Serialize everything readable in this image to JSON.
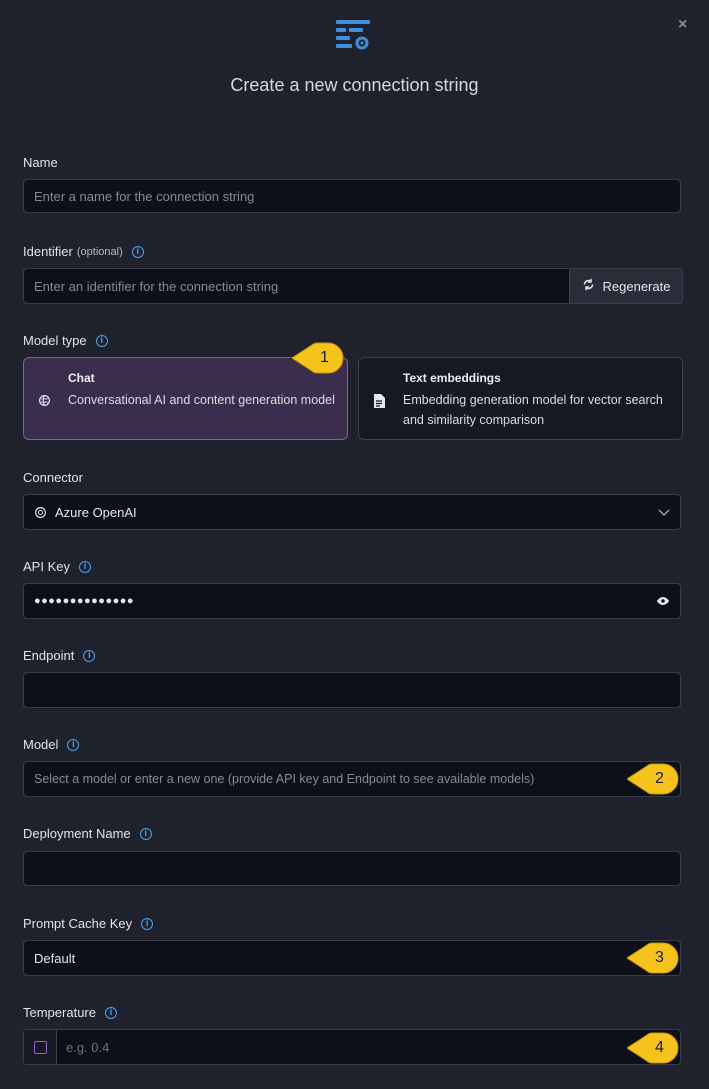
{
  "dialog": {
    "title": "Create a new connection string",
    "close_label": "×"
  },
  "name": {
    "label": "Name",
    "placeholder": "Enter a name for the connection string",
    "value": ""
  },
  "identifier": {
    "label": "Identifier",
    "optional": "(optional)",
    "placeholder": "Enter an identifier for the connection string",
    "regenerate_label": "Regenerate"
  },
  "model_type": {
    "label": "Model type",
    "options": [
      {
        "title": "Chat",
        "description": "Conversational AI and content generation model",
        "selected": true
      },
      {
        "title": "Text embeddings",
        "description": "Embedding generation model for vector search and similarity comparison",
        "selected": false
      }
    ]
  },
  "connector": {
    "label": "Connector",
    "value": "Azure OpenAI"
  },
  "api_key": {
    "label": "API Key",
    "value": "●●●●●●●●●●●●●●"
  },
  "endpoint": {
    "label": "Endpoint",
    "value": ""
  },
  "model": {
    "label": "Model",
    "placeholder": "Select a model or enter a new one (provide API key and Endpoint to see available models)"
  },
  "deployment_name": {
    "label": "Deployment Name",
    "value": ""
  },
  "prompt_cache_key": {
    "label": "Prompt Cache Key",
    "value": "Default"
  },
  "temperature": {
    "label": "Temperature",
    "placeholder": "e.g. 0.4",
    "enabled": false
  },
  "callouts": [
    "1",
    "2",
    "3",
    "4"
  ],
  "colors": {
    "accent": "#4aa3f0",
    "selected_card": "#3a2e4c",
    "callout": "#f6c21c",
    "background": "#1f212d"
  }
}
